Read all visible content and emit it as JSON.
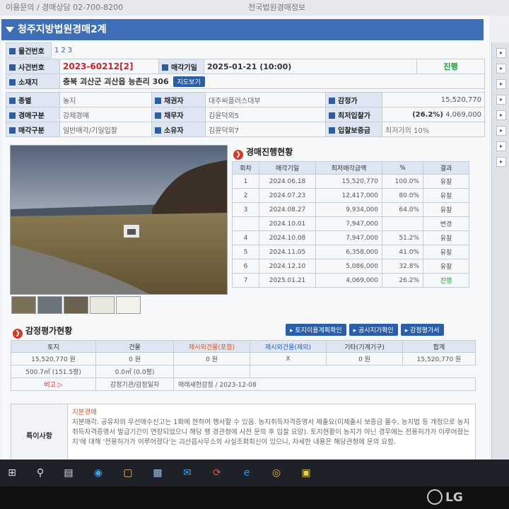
{
  "top_bar": {
    "text_left": "이용문의 / 경매상담 02-700-8200",
    "text_right": "전국법원경매정보"
  },
  "title": "청주지방법원경매2계",
  "info": {
    "item_no_label": "물건번호",
    "item_numbers": [
      "1",
      "2",
      "3"
    ],
    "case_no_label": "사건번호",
    "case_no": "2023-60212[2]",
    "sale_date_label": "매각기일",
    "sale_date": "2025-01-21 (10:00)",
    "status": "진행",
    "location_label": "소재지",
    "location": "충북 괴산군 괴산읍 능촌리 306",
    "map_button": "지도보기",
    "type_label": "종별",
    "type": "농지",
    "creditor_label": "채권자",
    "creditor": "대주씨플러스대부",
    "appraisal_label": "감정가",
    "appraisal": "15,520,770",
    "auction_kind_label": "경매구분",
    "auction_kind": "강제경매",
    "debtor_label": "채무자",
    "debtor": "김윤덕외5",
    "min_bid_label": "최저입찰가",
    "min_bid_pct": "(26.2%)",
    "min_bid": "4,069,000",
    "sale_kind_label": "매각구분",
    "sale_kind": "일반매각/기일입찰",
    "owner_label": "소유자",
    "owner": "김윤덕외7",
    "deposit_label": "입찰보증금",
    "deposit": "최저가의 10%"
  },
  "progress": {
    "title": "경매진행현황",
    "headers": [
      "회차",
      "매각기일",
      "최저매각금액",
      "%",
      "결과"
    ],
    "rows": [
      {
        "round": "1",
        "date": "2024.06.18",
        "amount": "15,520,770",
        "pct": "100.0%",
        "result": "유찰"
      },
      {
        "round": "2",
        "date": "2024.07.23",
        "amount": "12,417,000",
        "pct": "80.0%",
        "result": "유찰"
      },
      {
        "round": "3",
        "date": "2024.08.27",
        "amount": "9,934,000",
        "pct": "64.0%",
        "result": "유찰"
      },
      {
        "round": "",
        "date": "2024.10.01",
        "amount": "7,947,000",
        "pct": "",
        "result": "변경"
      },
      {
        "round": "4",
        "date": "2024.10.08",
        "amount": "7,947,000",
        "pct": "51.2%",
        "result": "유찰"
      },
      {
        "round": "5",
        "date": "2024.11.05",
        "amount": "6,358,000",
        "pct": "41.0%",
        "result": "유찰"
      },
      {
        "round": "6",
        "date": "2024.12.10",
        "amount": "5,086,000",
        "pct": "32.8%",
        "result": "유찰"
      },
      {
        "round": "7",
        "date": "2025.01.21",
        "amount": "4,069,000",
        "pct": "26.2%",
        "result": "진행"
      }
    ]
  },
  "appraisal": {
    "title": "감정평가현황",
    "buttons": [
      "토지이용계획확인",
      "공시지가확인",
      "감정평가서"
    ],
    "headers": [
      "토지",
      "건물",
      "제시외건물(포함)",
      "제시외건물(제외)",
      "기타(기계기구)",
      "합계"
    ],
    "row1": [
      "15,520,770 원",
      "0 원",
      "0 원",
      "X",
      "0 원",
      "15,520,770 원"
    ],
    "row2": [
      "500.7㎡ (151.5평)",
      "0.0㎡ (0.0평)"
    ],
    "note_label": "비고 ▷",
    "appraiser_label": "감정기관/감정일자",
    "appraiser": "매래새한감정 / 2023-12-08"
  },
  "special": {
    "label": "특이사항",
    "heading": "지분경매",
    "text": "지분매각. 공유자의 우선매수신고는 1회에 한하여 행사할 수 있음. 농지취득자격증명서 제출요(미제출시 보증금 몰수, 농지법 등 개정으로 농지취득자격증명서 발급기간이 연장되었으니 해당 행 경관청에 사전 문의 후 입찰 요망). 토지현황이 농지가 아닌 경우에는 전용허가가 이루어졌는지'에 대해 '전용허가가 이루어졌다'는 괴산읍사무소의 사실조회회신이 있으니, 자세한 내용은 해당관청에 문의 요함."
  },
  "brand": "LG"
}
